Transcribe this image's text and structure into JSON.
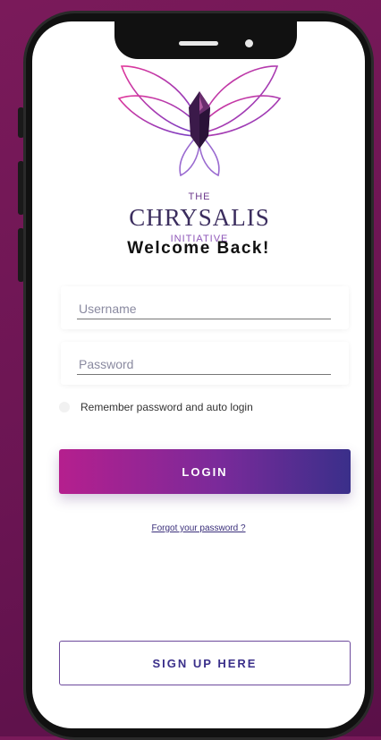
{
  "logo": {
    "the": "THE",
    "name": "CHRYSALIS",
    "subtitle": "INITIATIVE",
    "icon": "butterfly-crystal-icon"
  },
  "welcome": "Welcome Back!",
  "form": {
    "username_placeholder": "Username",
    "password_placeholder": "Password",
    "remember_label": "Remember password and auto login"
  },
  "login_label": "LOGIN",
  "forgot_label": "Forgot your password ?",
  "signup_label": "SIGN UP HERE",
  "colors": {
    "background": "#6b1553",
    "gradient_start": "#b51f8e",
    "gradient_end": "#3a2f8a",
    "accent_text": "#3a2f8a"
  }
}
